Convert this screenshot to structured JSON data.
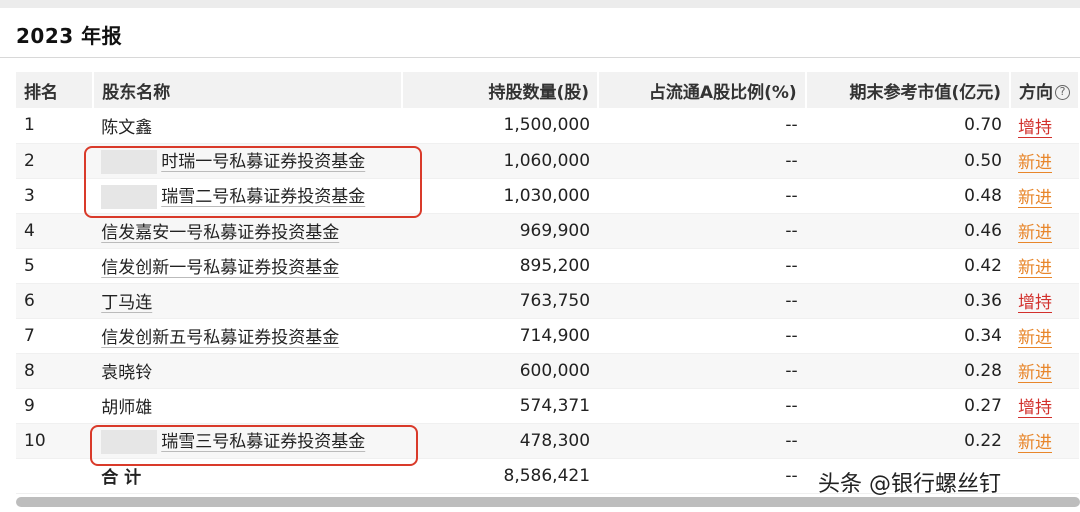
{
  "page": {
    "title": "2023 年报"
  },
  "table": {
    "headers": {
      "rank": "排名",
      "name": "股东名称",
      "shares": "持股数量(股)",
      "pct": "占流通A股比例(%)",
      "value": "期末参考市值(亿元)",
      "direction": "方向"
    },
    "help_icon": "question-circle-icon",
    "rows": [
      {
        "rank": "1",
        "name": "陈文鑫",
        "shares": "1,500,000",
        "pct": "--",
        "value": "0.70",
        "direction": "增持"
      },
      {
        "rank": "2",
        "name": "时瑞一号私募证券投资基金",
        "shares": "1,060,000",
        "pct": "--",
        "value": "0.50",
        "direction": "新进"
      },
      {
        "rank": "3",
        "name": "瑞雪二号私募证券投资基金",
        "shares": "1,030,000",
        "pct": "--",
        "value": "0.48",
        "direction": "新进"
      },
      {
        "rank": "4",
        "name": "信发嘉安一号私募证券投资基金",
        "shares": "969,900",
        "pct": "--",
        "value": "0.46",
        "direction": "新进"
      },
      {
        "rank": "5",
        "name": "信发创新一号私募证券投资基金",
        "shares": "895,200",
        "pct": "--",
        "value": "0.42",
        "direction": "新进"
      },
      {
        "rank": "6",
        "name": "丁马连",
        "shares": "763,750",
        "pct": "--",
        "value": "0.36",
        "direction": "增持"
      },
      {
        "rank": "7",
        "name": "信发创新五号私募证券投资基金",
        "shares": "714,900",
        "pct": "--",
        "value": "0.34",
        "direction": "新进"
      },
      {
        "rank": "8",
        "name": "袁晓铃",
        "shares": "600,000",
        "pct": "--",
        "value": "0.28",
        "direction": "新进"
      },
      {
        "rank": "9",
        "name": "胡师雄",
        "shares": "574,371",
        "pct": "--",
        "value": "0.27",
        "direction": "增持"
      },
      {
        "rank": "10",
        "name": "瑞雪三号私募证券投资基金",
        "shares": "478,300",
        "pct": "--",
        "value": "0.22",
        "direction": "新进"
      }
    ],
    "total": {
      "label": "合 计",
      "shares": "8,586,421",
      "pct": "--"
    }
  },
  "colors": {
    "highlight": "#d93a2a",
    "increase": "#d2302c",
    "new": "#e8862a"
  },
  "watermark": "头条 @银行螺丝钉"
}
